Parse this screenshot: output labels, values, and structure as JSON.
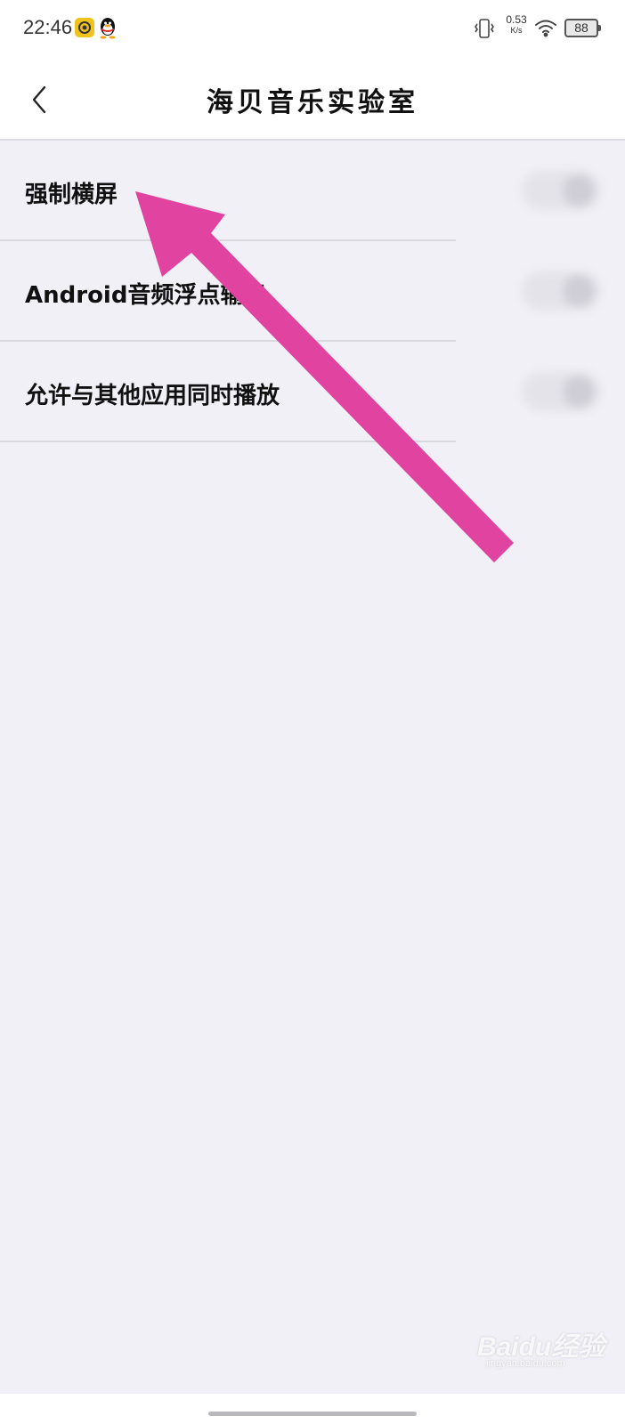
{
  "status_bar": {
    "time": "22:46",
    "net_speed_value": "0.53",
    "net_speed_unit": "K/s",
    "battery": "88",
    "icons": [
      "yellow-app-icon",
      "qq-penguin-icon",
      "vibrate-icon",
      "wifi-icon",
      "battery-icon"
    ]
  },
  "header": {
    "title": "海贝音乐实验室",
    "back_icon": "chevron-left-icon"
  },
  "settings": [
    {
      "label": "强制横屏"
    },
    {
      "label": "Android音频浮点输出"
    },
    {
      "label": "允许与其他应用同时播放"
    }
  ],
  "annotation": {
    "color": "#e043a0",
    "icon": "arrow-annotation-icon"
  },
  "watermark": {
    "brand": "Baidu经验",
    "url": "jingyan.baidu.com"
  },
  "colors": {
    "background": "#f1f0f6",
    "header_bg": "#ffffff",
    "arrow": "#e043a0",
    "qq_yellow": "#f1c21b"
  }
}
